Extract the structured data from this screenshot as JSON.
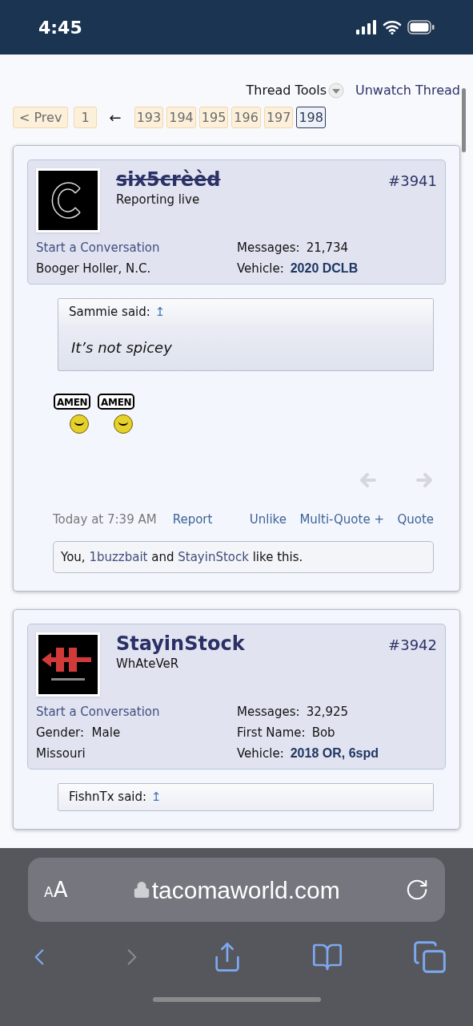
{
  "status_bar": {
    "time": "4:45"
  },
  "thread_tools": {
    "tools": "Thread Tools",
    "unwatch": "Unwatch Thread"
  },
  "pagination": {
    "prev": "< Prev",
    "first": "1",
    "gap": "←",
    "pages": [
      {
        "label": "193",
        "selected": false
      },
      {
        "label": "194",
        "selected": false
      },
      {
        "label": "195",
        "selected": false
      },
      {
        "label": "196",
        "selected": false
      },
      {
        "label": "197",
        "selected": false
      },
      {
        "label": "198",
        "selected": true
      }
    ]
  },
  "posts": [
    {
      "username": "six5crèèd",
      "banned": true,
      "title": "Reporting live",
      "number": "#3941",
      "start_conversation": "Start a Conversation",
      "left_fields": [
        {
          "text": "Booger Holler, N.C."
        }
      ],
      "right_fields": [
        {
          "label": "Messages:",
          "value": "21,734",
          "kind": "plain"
        },
        {
          "label": "Vehicle:",
          "value": "2020 DCLB",
          "kind": "bold"
        }
      ],
      "quote": {
        "author": "Sammie said:",
        "arrow": "↥",
        "body": "It’s not spicey"
      },
      "smilies": [
        "AMEN",
        "AMEN"
      ],
      "nav_arrows": true,
      "date": "Today at 7:39 AM",
      "actions": [
        "Report",
        "Unlike",
        "Multi-Quote +",
        "Quote"
      ],
      "likes": [
        {
          "text": "You, ",
          "link": false
        },
        {
          "text": "1buzzbait",
          "link": true
        },
        {
          "text": " and ",
          "link": false
        },
        {
          "text": "StayinStock",
          "link": true
        },
        {
          "text": " like this.",
          "link": false
        }
      ]
    },
    {
      "username": "StayinStock",
      "banned": false,
      "title": "WhAteVeR",
      "number": "#3942",
      "start_conversation": "Start a Conversation",
      "left_fields": [
        {
          "label": "Gender:",
          "text": "Male"
        },
        {
          "text": "Missouri"
        }
      ],
      "right_fields": [
        {
          "label": "Messages:",
          "value": "32,925",
          "kind": "plain"
        },
        {
          "label": "First Name:",
          "value": "Bob",
          "kind": "plain"
        },
        {
          "label": "Vehicle:",
          "value": "2018 OR, 6spd",
          "kind": "bold"
        }
      ],
      "quote": {
        "author": "FishnTx said:",
        "arrow": "↥"
      }
    }
  ],
  "browser": {
    "size_small": "A",
    "size_large": "A",
    "url": "tacomaworld.com"
  }
}
